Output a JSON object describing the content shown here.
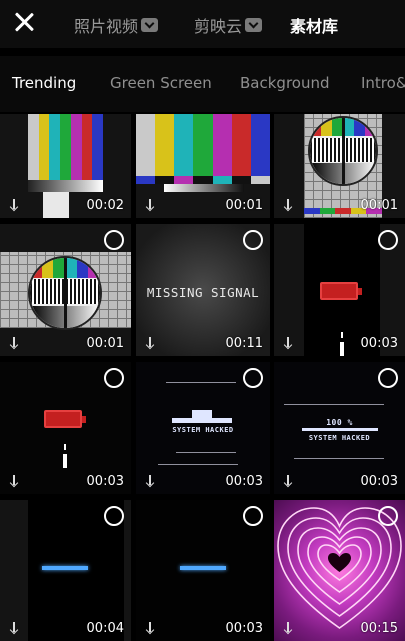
{
  "header": {
    "source_tabs": [
      {
        "label": "照片视频",
        "active": false,
        "has_dropdown": true
      },
      {
        "label": "剪映云",
        "active": false,
        "has_dropdown": true
      },
      {
        "label": "素材库",
        "active": true,
        "has_dropdown": false
      }
    ]
  },
  "categories": [
    {
      "label": "Trending",
      "active": true
    },
    {
      "label": "Green Screen",
      "active": false
    },
    {
      "label": "Background",
      "active": false
    },
    {
      "label": "Intro&",
      "active": false
    }
  ],
  "clips": [
    {
      "duration": "00:02",
      "thumb": "color-bars",
      "selectable": false
    },
    {
      "duration": "00:01",
      "thumb": "color-bars-wide",
      "selectable": false
    },
    {
      "duration": "00:01",
      "thumb": "test-card",
      "selectable": false
    },
    {
      "duration": "00:01",
      "thumb": "test-card",
      "selectable": true
    },
    {
      "duration": "00:11",
      "thumb": "missing-signal",
      "caption": "MISSING SIGNAL",
      "selectable": true
    },
    {
      "duration": "00:03",
      "thumb": "low-battery",
      "selectable": true
    },
    {
      "duration": "00:03",
      "thumb": "low-battery",
      "selectable": true
    },
    {
      "duration": "00:03",
      "thumb": "system-hacked",
      "caption": "SYSTEM HACKED",
      "selectable": true
    },
    {
      "duration": "00:03",
      "thumb": "system-hacked-100",
      "caption": "SYSTEM HACKED",
      "caption_top": "100 %",
      "selectable": true
    },
    {
      "duration": "00:04",
      "thumb": "loading-bar",
      "selectable": true
    },
    {
      "duration": "00:03",
      "thumb": "loading-bar",
      "selectable": true
    },
    {
      "duration": "00:15",
      "thumb": "neon-heart",
      "selectable": true
    }
  ],
  "colors": {
    "bar_colors": [
      "#c9c9c9",
      "#d8c21a",
      "#1fb3b8",
      "#1fa83a",
      "#b52fb0",
      "#c92a2a",
      "#2a38c4"
    ],
    "neon_pink": "#ff7be0"
  }
}
